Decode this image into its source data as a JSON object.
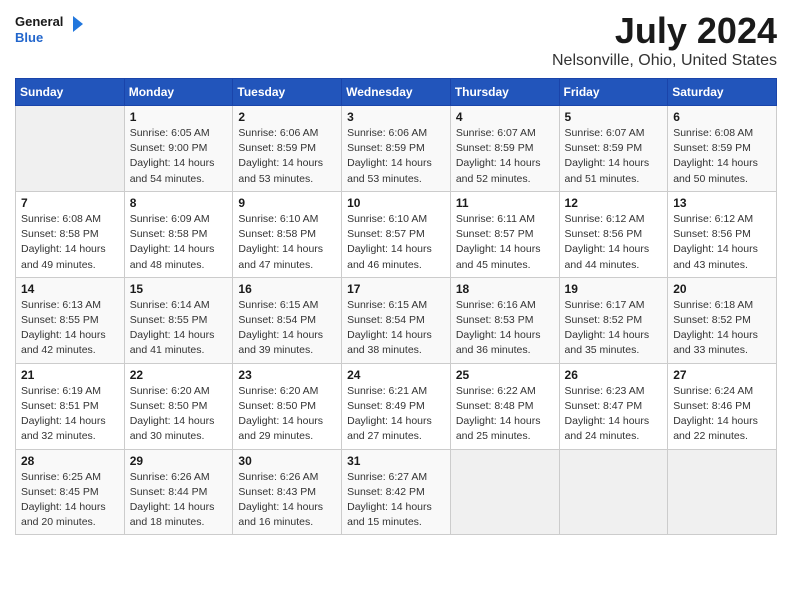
{
  "logo": {
    "line1": "General",
    "line2": "Blue"
  },
  "title": "July 2024",
  "subtitle": "Nelsonville, Ohio, United States",
  "days_of_week": [
    "Sunday",
    "Monday",
    "Tuesday",
    "Wednesday",
    "Thursday",
    "Friday",
    "Saturday"
  ],
  "weeks": [
    [
      {
        "day": "",
        "info": ""
      },
      {
        "day": "1",
        "info": "Sunrise: 6:05 AM\nSunset: 9:00 PM\nDaylight: 14 hours\nand 54 minutes."
      },
      {
        "day": "2",
        "info": "Sunrise: 6:06 AM\nSunset: 8:59 PM\nDaylight: 14 hours\nand 53 minutes."
      },
      {
        "day": "3",
        "info": "Sunrise: 6:06 AM\nSunset: 8:59 PM\nDaylight: 14 hours\nand 53 minutes."
      },
      {
        "day": "4",
        "info": "Sunrise: 6:07 AM\nSunset: 8:59 PM\nDaylight: 14 hours\nand 52 minutes."
      },
      {
        "day": "5",
        "info": "Sunrise: 6:07 AM\nSunset: 8:59 PM\nDaylight: 14 hours\nand 51 minutes."
      },
      {
        "day": "6",
        "info": "Sunrise: 6:08 AM\nSunset: 8:59 PM\nDaylight: 14 hours\nand 50 minutes."
      }
    ],
    [
      {
        "day": "7",
        "info": "Sunrise: 6:08 AM\nSunset: 8:58 PM\nDaylight: 14 hours\nand 49 minutes."
      },
      {
        "day": "8",
        "info": "Sunrise: 6:09 AM\nSunset: 8:58 PM\nDaylight: 14 hours\nand 48 minutes."
      },
      {
        "day": "9",
        "info": "Sunrise: 6:10 AM\nSunset: 8:58 PM\nDaylight: 14 hours\nand 47 minutes."
      },
      {
        "day": "10",
        "info": "Sunrise: 6:10 AM\nSunset: 8:57 PM\nDaylight: 14 hours\nand 46 minutes."
      },
      {
        "day": "11",
        "info": "Sunrise: 6:11 AM\nSunset: 8:57 PM\nDaylight: 14 hours\nand 45 minutes."
      },
      {
        "day": "12",
        "info": "Sunrise: 6:12 AM\nSunset: 8:56 PM\nDaylight: 14 hours\nand 44 minutes."
      },
      {
        "day": "13",
        "info": "Sunrise: 6:12 AM\nSunset: 8:56 PM\nDaylight: 14 hours\nand 43 minutes."
      }
    ],
    [
      {
        "day": "14",
        "info": "Sunrise: 6:13 AM\nSunset: 8:55 PM\nDaylight: 14 hours\nand 42 minutes."
      },
      {
        "day": "15",
        "info": "Sunrise: 6:14 AM\nSunset: 8:55 PM\nDaylight: 14 hours\nand 41 minutes."
      },
      {
        "day": "16",
        "info": "Sunrise: 6:15 AM\nSunset: 8:54 PM\nDaylight: 14 hours\nand 39 minutes."
      },
      {
        "day": "17",
        "info": "Sunrise: 6:15 AM\nSunset: 8:54 PM\nDaylight: 14 hours\nand 38 minutes."
      },
      {
        "day": "18",
        "info": "Sunrise: 6:16 AM\nSunset: 8:53 PM\nDaylight: 14 hours\nand 36 minutes."
      },
      {
        "day": "19",
        "info": "Sunrise: 6:17 AM\nSunset: 8:52 PM\nDaylight: 14 hours\nand 35 minutes."
      },
      {
        "day": "20",
        "info": "Sunrise: 6:18 AM\nSunset: 8:52 PM\nDaylight: 14 hours\nand 33 minutes."
      }
    ],
    [
      {
        "day": "21",
        "info": "Sunrise: 6:19 AM\nSunset: 8:51 PM\nDaylight: 14 hours\nand 32 minutes."
      },
      {
        "day": "22",
        "info": "Sunrise: 6:20 AM\nSunset: 8:50 PM\nDaylight: 14 hours\nand 30 minutes."
      },
      {
        "day": "23",
        "info": "Sunrise: 6:20 AM\nSunset: 8:50 PM\nDaylight: 14 hours\nand 29 minutes."
      },
      {
        "day": "24",
        "info": "Sunrise: 6:21 AM\nSunset: 8:49 PM\nDaylight: 14 hours\nand 27 minutes."
      },
      {
        "day": "25",
        "info": "Sunrise: 6:22 AM\nSunset: 8:48 PM\nDaylight: 14 hours\nand 25 minutes."
      },
      {
        "day": "26",
        "info": "Sunrise: 6:23 AM\nSunset: 8:47 PM\nDaylight: 14 hours\nand 24 minutes."
      },
      {
        "day": "27",
        "info": "Sunrise: 6:24 AM\nSunset: 8:46 PM\nDaylight: 14 hours\nand 22 minutes."
      }
    ],
    [
      {
        "day": "28",
        "info": "Sunrise: 6:25 AM\nSunset: 8:45 PM\nDaylight: 14 hours\nand 20 minutes."
      },
      {
        "day": "29",
        "info": "Sunrise: 6:26 AM\nSunset: 8:44 PM\nDaylight: 14 hours\nand 18 minutes."
      },
      {
        "day": "30",
        "info": "Sunrise: 6:26 AM\nSunset: 8:43 PM\nDaylight: 14 hours\nand 16 minutes."
      },
      {
        "day": "31",
        "info": "Sunrise: 6:27 AM\nSunset: 8:42 PM\nDaylight: 14 hours\nand 15 minutes."
      },
      {
        "day": "",
        "info": ""
      },
      {
        "day": "",
        "info": ""
      },
      {
        "day": "",
        "info": ""
      }
    ]
  ]
}
